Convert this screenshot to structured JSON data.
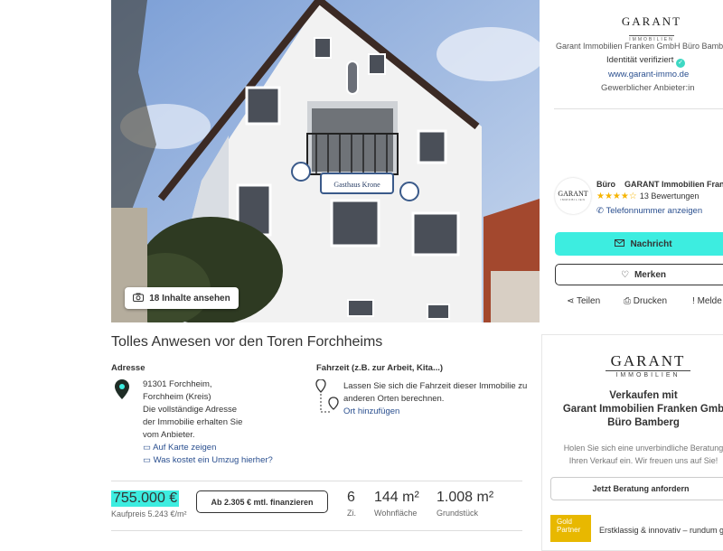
{
  "gallery": {
    "media_label": "18 Inhalte ansehen",
    "sign_text": "Gasthaus Krone"
  },
  "agent_panel": {
    "logo_main": "GARANT",
    "logo_sub": "IMMOBILIEN",
    "company_name": "Garant Immobilien Franken GmbH Büro Bamb",
    "verified_label": "Identität verifiziert",
    "website": "www.garant-immo.de",
    "seller_type": "Gewerblicher Anbieter:in",
    "agent_logo_main": "GARANT",
    "agent_logo_sub": "IMMOBILIEN",
    "agent_name": "Büro    GARANT Immobilien Franken B",
    "rating_stars": "★★★★☆",
    "rating_count": "13 Bewertungen",
    "rating_value": 4,
    "phone_label": "Telefonnummer anzeigen",
    "message_button": "Nachricht",
    "save_button": "Merken",
    "share_label": "Teilen",
    "print_label": "Drucken",
    "report_label": "Melde"
  },
  "listing": {
    "title": "Tolles Anwesen vor den Toren Forchheims",
    "address_label": "Adresse",
    "address_line1": "91301 Forchheim,",
    "address_line2": "Forchheim (Kreis)",
    "address_note1": "Die vollständige Adresse",
    "address_note2": "der Immobilie erhalten Sie",
    "address_note3": "vom Anbieter.",
    "map_link": "Auf Karte zeigen",
    "moving_cost_link": "Was kostet ein Umzug hierher?",
    "drive_label": "Fahrzeit (z.B. zur Arbeit, Kita...)",
    "drive_text1": "Lassen Sie sich die Fahrzeit dieser Immobilie zu",
    "drive_text2": "anderen Orten berechnen.",
    "add_location_link": "Ort hinzufügen",
    "price": "755.000 €",
    "price_sub": "Kaufpreis 5.243 €/m²",
    "finance_button": "Ab 2.305 € mtl. finanzieren",
    "facts": [
      {
        "value": "6",
        "label": "Zi."
      },
      {
        "value": "144 m²",
        "label": "Wohnfläche"
      },
      {
        "value": "1.008 m²",
        "label": "Grundstück"
      }
    ]
  },
  "promo": {
    "logo_main": "GARANT",
    "logo_sub": "IMMOBILIEN",
    "title1": "Verkaufen mit",
    "title2": "Garant Immobilien Franken Gmb",
    "title3": "Büro Bamberg",
    "text1": "Holen Sie sich eine unverbindliche Beratung",
    "text2": "Ihren Verkauf ein. Wir freuen uns auf Sie!",
    "button": "Jetzt Beratung anfordern",
    "badge_line1": "Gold",
    "badge_line2": "Partner",
    "badge_text": "Erstklassig & innovativ – rundum g"
  },
  "colors": {
    "accent": "#3dede0",
    "link": "#2a4f8f",
    "star": "#f6b400"
  }
}
